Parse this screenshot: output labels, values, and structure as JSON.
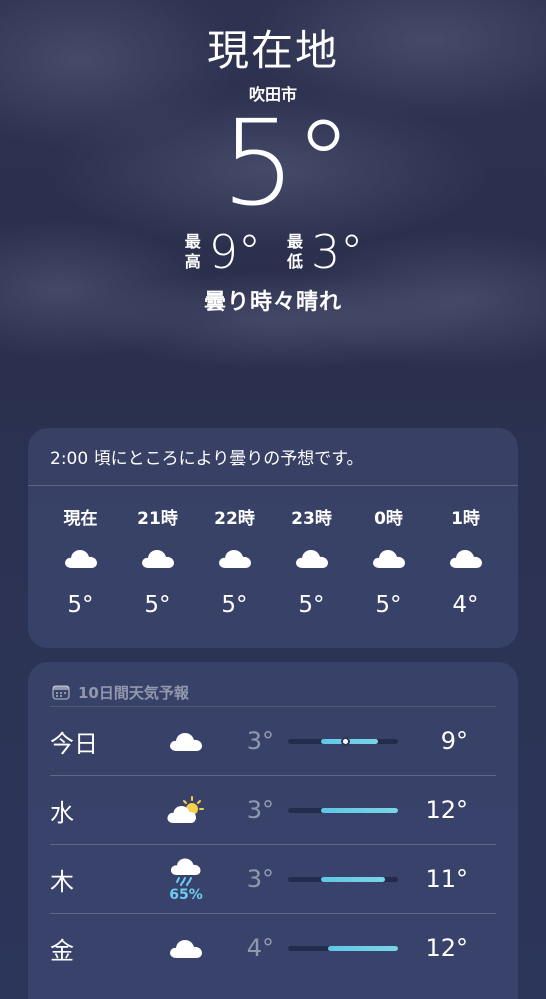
{
  "header": {
    "location": "現在地",
    "city": "吹田市",
    "temperature": "5°",
    "high_label": "最高",
    "high": "9°",
    "low_label": "最低",
    "low": "3°",
    "condition": "曇り時々晴れ"
  },
  "hourly": {
    "summary": "2:00 頃にところにより曇りの予想です。",
    "items": [
      {
        "label": "現在",
        "icon": "cloud-icon",
        "temp": "5°"
      },
      {
        "label": "21時",
        "icon": "cloud-icon",
        "temp": "5°"
      },
      {
        "label": "22時",
        "icon": "cloud-icon",
        "temp": "5°"
      },
      {
        "label": "23時",
        "icon": "cloud-icon",
        "temp": "5°"
      },
      {
        "label": "0時",
        "icon": "cloud-icon",
        "temp": "5°"
      },
      {
        "label": "1時",
        "icon": "cloud-icon",
        "temp": "4°"
      }
    ]
  },
  "forecast": {
    "title": "10日間天気予報",
    "icon": "calendar-icon",
    "days": [
      {
        "day": "今日",
        "icon": "cloud-icon",
        "precip": "",
        "low": "3°",
        "high": "9°",
        "range_start": 0.3,
        "range_end": 0.82,
        "current": 0.52
      },
      {
        "day": "水",
        "icon": "partly-sunny-icon",
        "precip": "",
        "low": "3°",
        "high": "12°",
        "range_start": 0.3,
        "range_end": 1.0
      },
      {
        "day": "木",
        "icon": "cloud-rain-icon",
        "precip": "65%",
        "low": "3°",
        "high": "11°",
        "range_start": 0.3,
        "range_end": 0.88
      },
      {
        "day": "金",
        "icon": "cloud-icon",
        "precip": "",
        "low": "4°",
        "high": "12°",
        "range_start": 0.36,
        "range_end": 1.0
      }
    ]
  },
  "colors": {
    "background": "#2c3254",
    "card": "#4a5682",
    "range_bar": "#5ec7e6",
    "precip_text": "#6ccdf3"
  }
}
